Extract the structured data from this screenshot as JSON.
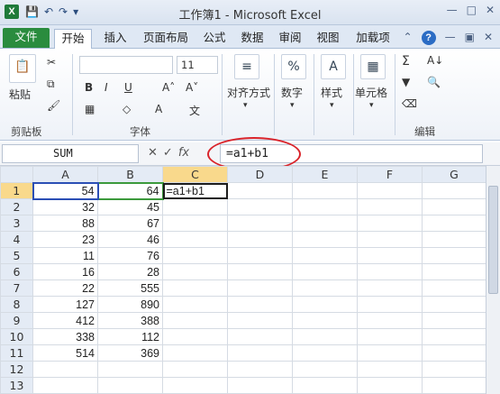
{
  "window": {
    "title": "工作簿1 - Microsoft Excel",
    "app_icon_glyph": "X",
    "qat": {
      "save_icon": "save-icon",
      "undo_icon": "undo-icon",
      "redo_icon": "redo-icon"
    },
    "controls": {
      "minimize": "—",
      "restore": "□",
      "close": "✕"
    }
  },
  "tabs": [
    "文件",
    "开始",
    "插入",
    "页面布局",
    "公式",
    "数据",
    "审阅",
    "视图",
    "加载项"
  ],
  "active_tab": "开始",
  "ribbon": {
    "clipboard": {
      "paste": "粘贴",
      "label": "剪贴板"
    },
    "font": {
      "name": "",
      "size": "11",
      "label": "字体"
    },
    "alignment": {
      "label": "对齐方式"
    },
    "number": {
      "label": "数字"
    },
    "styles": {
      "label": "样式"
    },
    "cells": {
      "label": "单元格"
    },
    "editing": {
      "label": "编辑"
    }
  },
  "formula_bar": {
    "name_box": "SUM",
    "fx_label": "fx",
    "formula": "=a1+b1"
  },
  "sheet": {
    "columns": [
      "A",
      "B",
      "C",
      "D",
      "E",
      "F",
      "G"
    ],
    "rows": [
      {
        "n": "1",
        "a": "54",
        "b": "64",
        "c": "=a1+b1"
      },
      {
        "n": "2",
        "a": "32",
        "b": "45",
        "c": ""
      },
      {
        "n": "3",
        "a": "88",
        "b": "67",
        "c": ""
      },
      {
        "n": "4",
        "a": "23",
        "b": "46",
        "c": ""
      },
      {
        "n": "5",
        "a": "11",
        "b": "76",
        "c": ""
      },
      {
        "n": "6",
        "a": "16",
        "b": "28",
        "c": ""
      },
      {
        "n": "7",
        "a": "22",
        "b": "555",
        "c": ""
      },
      {
        "n": "8",
        "a": "127",
        "b": "890",
        "c": ""
      },
      {
        "n": "9",
        "a": "412",
        "b": "388",
        "c": ""
      },
      {
        "n": "10",
        "a": "338",
        "b": "112",
        "c": ""
      },
      {
        "n": "11",
        "a": "514",
        "b": "369",
        "c": ""
      },
      {
        "n": "12",
        "a": "",
        "b": "",
        "c": ""
      },
      {
        "n": "13",
        "a": "",
        "b": "",
        "c": ""
      }
    ]
  },
  "colors": {
    "file_tab": "#2a8c3e",
    "selection_header": "#f9d98c",
    "annotation_circle": "#d9232a"
  }
}
